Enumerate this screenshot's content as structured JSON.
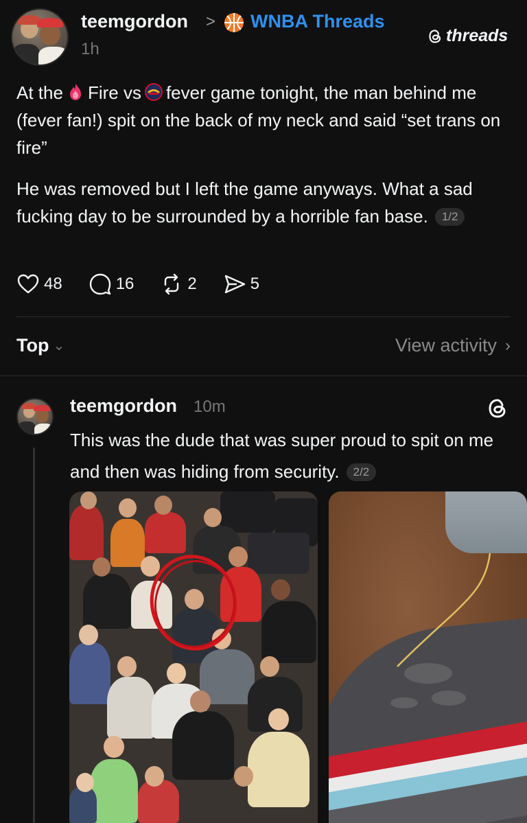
{
  "post": {
    "username": "teemgordon",
    "breadcrumb_separator": ">",
    "community": "WNBA Threads",
    "community_icon": "basketball-icon",
    "time": "1h",
    "brand": "threads",
    "para1_part1": "At the",
    "para1_emoji1": "fire-team-logo-icon",
    "para1_part2": "Fire vs",
    "para1_emoji2": "fever-team-logo-icon",
    "para1_part3": "fever game tonight, the man behind me (fever fan!) spit on the back of my neck and said “set trans on fire”",
    "para2": "He was removed but I left the game anyways. What a sad fucking day to be surrounded by a horrible fan base.",
    "page_indicator": "1/2",
    "likes": "48",
    "comments": "16",
    "reposts": "2",
    "shares": "5"
  },
  "sort": {
    "label": "Top",
    "view_activity": "View activity"
  },
  "reply": {
    "username": "teemgordon",
    "time": "10m",
    "text": "This was the dude that was super proud to spit on me and then was hiding from security.",
    "page_indicator": "2/2",
    "images": [
      "crowd-photo",
      "neck-photo"
    ]
  },
  "colors": {
    "background": "#101010",
    "text": "#f3f5f7",
    "muted": "#777777",
    "link": "#2e91f0",
    "circle": "#d2161c"
  }
}
